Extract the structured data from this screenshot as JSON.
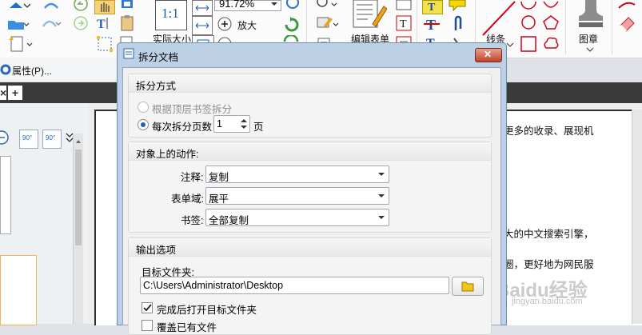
{
  "ribbon": {
    "zoom_value": "91.72%",
    "actual_size_label": "实际大小",
    "zoom_in_label": "放大",
    "edit_form_label": "编辑表单",
    "line_label": "线条",
    "stamp_label": "图章",
    "fit_icon_text": "1:1"
  },
  "toolbar2": {
    "properties_label": "属性(P)..."
  },
  "tabstrip": {
    "close_glyph": "×",
    "add_glyph": "+"
  },
  "left_panel": {
    "rotate_left_label": "90°",
    "rotate_right_label": "90°"
  },
  "document": {
    "line1": "更多的收录、展现机",
    "line2": "大的中文搜索引擎，",
    "line3": "圈，更好地为网民服",
    "watermark_brand": "Baidu经验",
    "watermark_url": "jingyan.baidu.com"
  },
  "dialog": {
    "title": "拆分文档",
    "close_glyph": "✕",
    "split_group": {
      "header": "拆分方式",
      "option_bookmarks": "根据顶层书签拆分",
      "option_pages": "每次拆分页数",
      "pages_value": "1",
      "pages_unit": "页"
    },
    "actions_group": {
      "header": "对象上的动作:",
      "annotations_label": "注释:",
      "annotations_value": "复制",
      "forms_label": "表单域:",
      "forms_value": "展平",
      "bookmarks_label": "书签:",
      "bookmarks_value": "全部复制"
    },
    "output_group": {
      "header": "输出选项",
      "folder_label": "目标文件夹:",
      "folder_value": "C:\\Users\\Administrator\\Desktop",
      "open_after_label": "完成后打开目标文件夹",
      "overwrite_label": "覆盖已有文件"
    }
  },
  "colors": {
    "accent": "#1f5fbf",
    "dialog_frame": "#bcd0e6",
    "red_shape": "#d0021b"
  }
}
